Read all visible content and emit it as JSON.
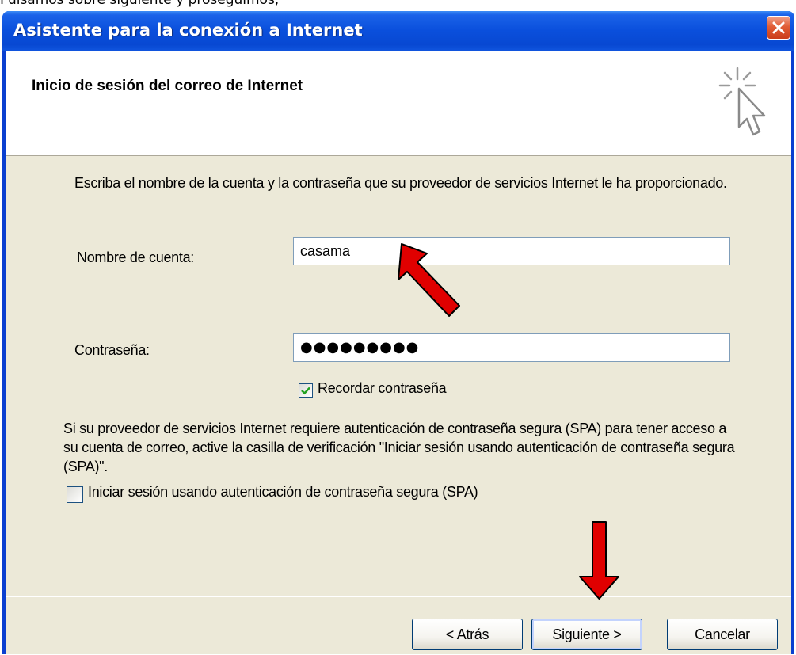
{
  "caption": {
    "text": "Pulsamos sobre siguiente y proseguimos;"
  },
  "window": {
    "title": "Asistente para la conexión a Internet",
    "close_icon": "close-icon"
  },
  "header": {
    "title": "Inicio de sesión del correo de Internet",
    "icon": "wizard-cursor-sparkle-icon"
  },
  "content": {
    "instructions": "Escriba el nombre de la cuenta y la contraseña que su proveedor de servicios Internet le ha proporcionado.",
    "account_label": "Nombre de cuenta:",
    "account_value": "casama",
    "password_label": "Contraseña:",
    "password_value": "●●●●●●●●●",
    "remember_label": "Recordar contraseña",
    "remember_checked": true,
    "spa_description": "Si su proveedor de servicios Internet requiere autenticación de contraseña segura (SPA) para tener acceso a su cuenta de correo, active la casilla de verificación \"Iniciar sesión usando autenticación de contraseña segura (SPA)\".",
    "spa_label": "Iniciar sesión usando autenticación de contraseña segura (SPA)",
    "spa_checked": false
  },
  "buttons": {
    "back": "< Atrás",
    "next": "Siguiente >",
    "cancel": "Cancelar"
  },
  "colors": {
    "titlebar": "#0a4fdc",
    "dialog_bg": "#ece9d8",
    "annotation_arrow": "#e00000"
  }
}
